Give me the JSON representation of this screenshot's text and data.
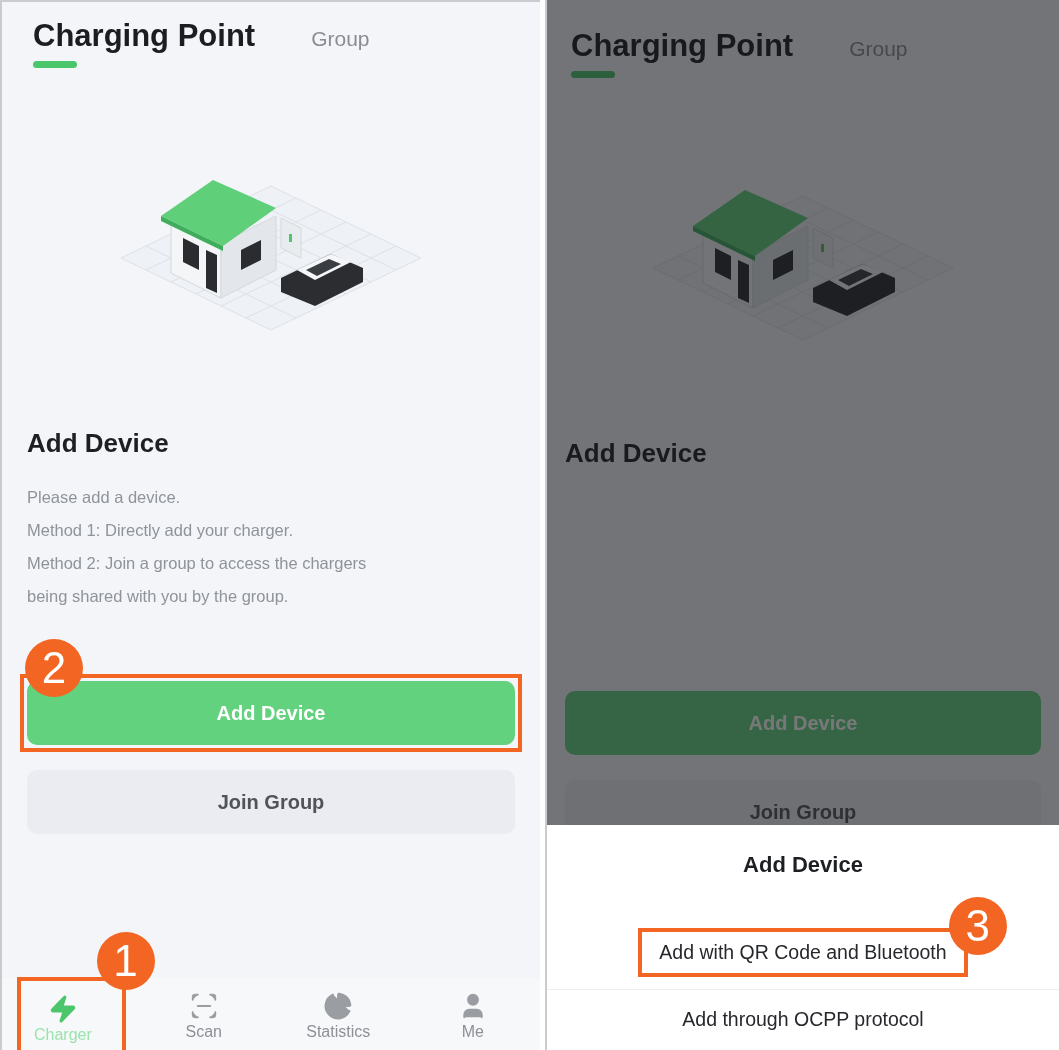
{
  "screens": [
    {
      "tabs": [
        {
          "label": "Charging Point",
          "selected": true
        },
        {
          "label": "Group",
          "selected": false
        }
      ],
      "heading": "Add Device",
      "description": [
        "Please add a device.",
        "Method 1: Directly add your charger.",
        "Method 2: Join a group to access the chargers",
        "being shared with you by the group."
      ],
      "primary_button": {
        "label": "Add Device",
        "callout": "2"
      },
      "secondary_button": {
        "label": "Join Group"
      },
      "tab_bar": [
        {
          "label": "Charger",
          "selected": true,
          "callout": "1"
        },
        {
          "label": "Scan",
          "selected": false
        },
        {
          "label": "Statistics",
          "selected": false
        },
        {
          "label": "Me",
          "selected": false
        }
      ]
    },
    {
      "dimmed": true,
      "tabs": [
        {
          "label": "Charging Point",
          "selected": true
        },
        {
          "label": "Group",
          "selected": false
        }
      ],
      "heading": "Add Device",
      "primary_button": {
        "label": "Add Device"
      },
      "secondary_button": {
        "label": "Join Group"
      },
      "sheet": {
        "title": "Add Device",
        "options": [
          {
            "label": "Add with QR Code and Bluetooth",
            "callout": "3"
          },
          {
            "label": "Add through OCPP protocol"
          }
        ]
      }
    }
  ]
}
